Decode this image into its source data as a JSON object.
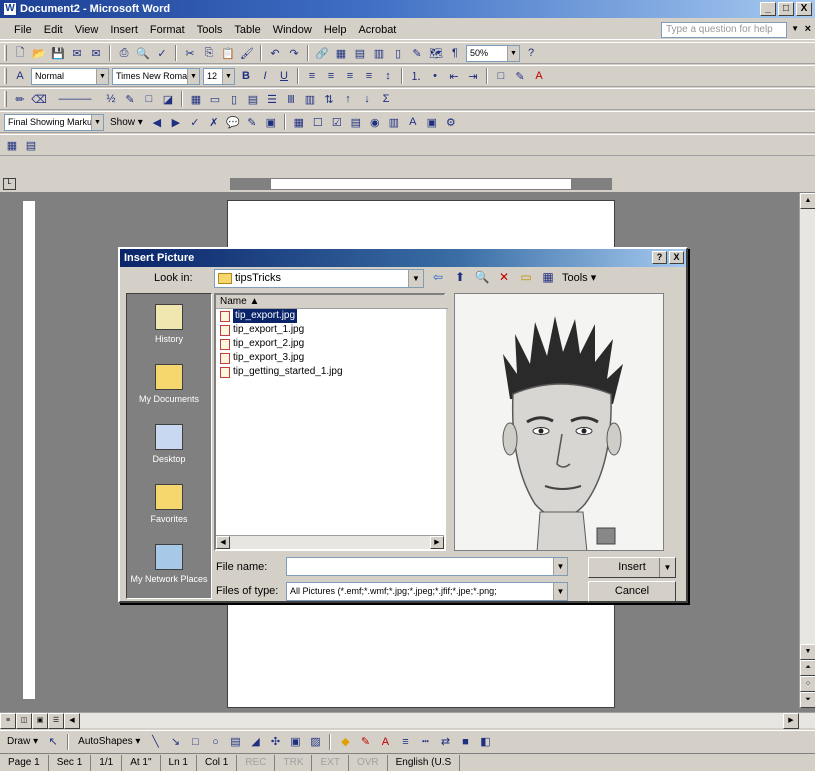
{
  "window": {
    "title": "Document2 - Microsoft Word",
    "controls": [
      "_",
      "□",
      "X"
    ]
  },
  "menubar": {
    "items": [
      "File",
      "Edit",
      "View",
      "Insert",
      "Format",
      "Tools",
      "Table",
      "Window",
      "Help",
      "Acrobat"
    ],
    "help_placeholder": "Type a question for help",
    "close": "×"
  },
  "toolbar_standard": {
    "zoom": "50%"
  },
  "toolbar_formatting": {
    "style": "Normal",
    "font": "Times New Roman",
    "size": "12"
  },
  "toolbar_reviewing": {
    "display": "Final Showing Markup",
    "show": "Show"
  },
  "dialog": {
    "title": "Insert Picture",
    "controls": [
      "?",
      "X"
    ],
    "look_in_label": "Look in:",
    "look_in_value": "tipsTricks",
    "tools_label": "Tools",
    "places": [
      "History",
      "My Documents",
      "Desktop",
      "Favorites",
      "My Network Places"
    ],
    "list_header": "Name",
    "files": [
      {
        "name": "tip_export.jpg",
        "selected": true
      },
      {
        "name": "tip_export_1.jpg",
        "selected": false
      },
      {
        "name": "tip_export_2.jpg",
        "selected": false
      },
      {
        "name": "tip_export_3.jpg",
        "selected": false
      },
      {
        "name": "tip_getting_started_1.jpg",
        "selected": false
      }
    ],
    "file_name_label": "File name:",
    "file_name_value": "",
    "files_of_type_label": "Files of type:",
    "files_of_type_value": "All Pictures (*.emf;*.wmf;*.jpg;*.jpeg;*.jfif;*.jpe;*.png;",
    "insert_label": "Insert",
    "cancel_label": "Cancel"
  },
  "drawbar": {
    "draw": "Draw",
    "autoshapes": "AutoShapes"
  },
  "status": {
    "page": "Page 1",
    "sec": "Sec 1",
    "pages": "1/1",
    "at": "At 1\"",
    "ln": "Ln 1",
    "col": "Col 1",
    "rec": "REC",
    "trk": "TRK",
    "ext": "EXT",
    "ovr": "OVR",
    "lang": "English (U.S"
  }
}
